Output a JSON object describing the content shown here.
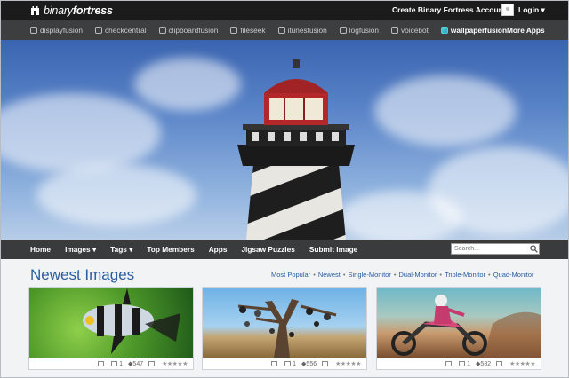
{
  "brand": {
    "part1": "binary",
    "part2": "fortress"
  },
  "top": {
    "create_account": "Create Binary Fortress Account",
    "login": "Login ▾"
  },
  "products": [
    {
      "label": "displayfusion",
      "icon": "monitors-icon"
    },
    {
      "label": "checkcentral",
      "icon": "check-icon"
    },
    {
      "label": "clipboardfusion",
      "icon": "clipboard-icon"
    },
    {
      "label": "fileseek",
      "icon": "magnifier-icon"
    },
    {
      "label": "itunesfusion",
      "icon": "music-icon"
    },
    {
      "label": "logfusion",
      "icon": "log-icon"
    },
    {
      "label": "voicebot",
      "icon": "voice-icon"
    },
    {
      "label": "wallpaperfusion",
      "icon": "wallpaper-icon",
      "active": true
    }
  ],
  "more_apps": "More Apps",
  "nav": {
    "home": "Home",
    "images": "Images ▾",
    "tags": "Tags ▾",
    "top_members": "Top Members",
    "apps": "Apps",
    "jigsaw": "Jigsaw Puzzles",
    "submit": "Submit Image",
    "search_placeholder": "Search..."
  },
  "section": {
    "title": "Newest Images",
    "filters": [
      "Most Popular",
      "Newest",
      "Single-Monitor",
      "Dual-Monitor",
      "Triple-Monitor",
      "Quad-Monitor"
    ]
  },
  "cards": [
    {
      "comments": "1",
      "views": "547",
      "stars": "★★★★★"
    },
    {
      "comments": "1",
      "views": "556",
      "stars": "★★★★★"
    },
    {
      "comments": "1",
      "views": "582",
      "stars": "★★★★★"
    }
  ],
  "colors": {
    "accent": "#2a5d9f",
    "topbar": "#1b1b1b",
    "nav": "#3d3e40",
    "active_icon": "#4fd1d9"
  }
}
